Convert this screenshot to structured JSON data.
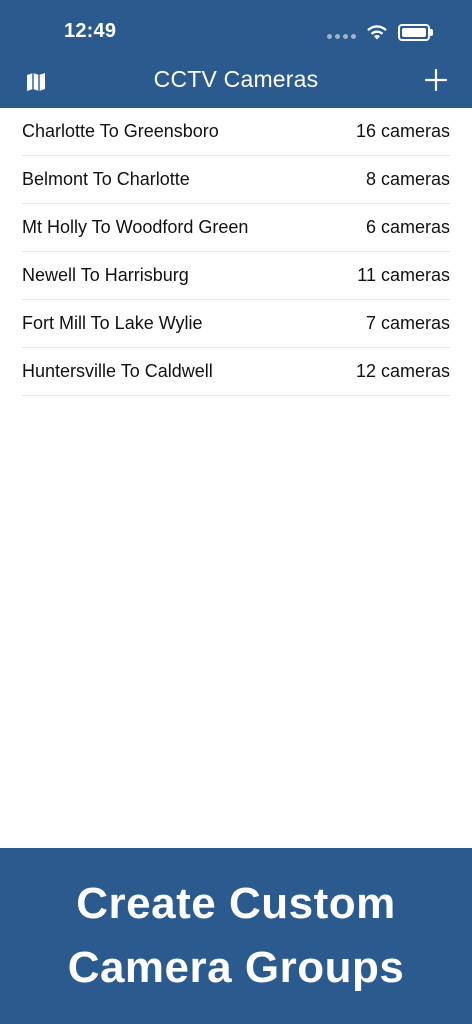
{
  "status_bar": {
    "time": "12:49"
  },
  "nav": {
    "title": "CCTV Cameras",
    "left_icon": "map-icon",
    "right_icon": "plus-icon"
  },
  "groups": [
    {
      "name": "Charlotte To Greensboro",
      "count": "16 cameras"
    },
    {
      "name": "Belmont To Charlotte",
      "count": "8 cameras"
    },
    {
      "name": "Mt Holly To Woodford Green",
      "count": "6 cameras"
    },
    {
      "name": "Newell To Harrisburg",
      "count": "11 cameras"
    },
    {
      "name": "Fort Mill To Lake Wylie",
      "count": "7 cameras"
    },
    {
      "name": "Huntersville To Caldwell",
      "count": "12 cameras"
    }
  ],
  "promo": {
    "line1": "Create Custom",
    "line2": "Camera Groups"
  },
  "colors": {
    "brand": "#2b5a8f",
    "separator": "#e5e5ea"
  }
}
